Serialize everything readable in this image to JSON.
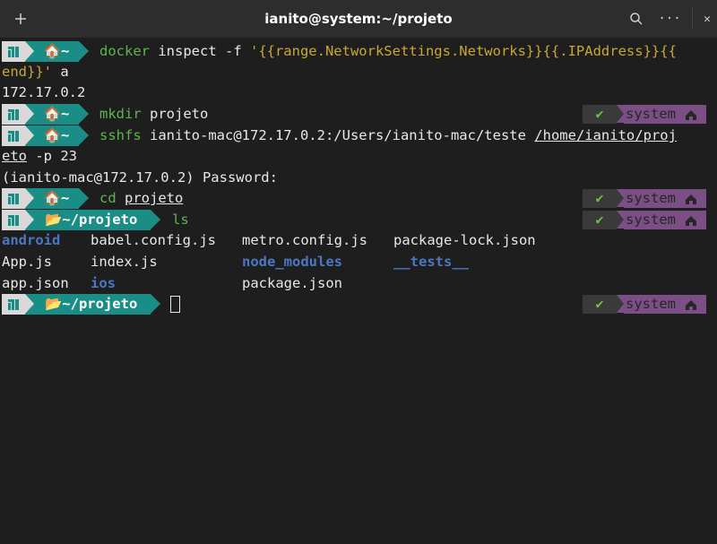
{
  "window": {
    "title": "ianito@system:~/projeto",
    "new_tab_label": "+",
    "search_icon": "search-icon",
    "menu_label": "···",
    "close_label": "✕"
  },
  "prompt": {
    "home_label": "🏠~",
    "dir_label": "📂~/projeto",
    "status_check": "✔",
    "status_label": "system"
  },
  "lines": {
    "l1_cmd": "docker",
    "l1_args": " inspect -f ",
    "l1_str": "'{{range.NetworkSettings.Networks}}{{.IPAddress}}{{",
    "l2_str": "end}}'",
    "l2_rest": " a",
    "l3": "172.17.0.2",
    "l4_cmd": "mkdir",
    "l4_args": " projeto",
    "l5_cmd": "sshfs",
    "l5_args": " ianito-mac@172.17.0.2:/Users/ianito-mac/teste ",
    "l5_path": "/home/ianito/proj",
    "l6_path": "eto",
    "l6_rest": " -p 23",
    "l7": "(ianito-mac@172.17.0.2) Password:",
    "l8_cmd": "cd",
    "l8_arg": "projeto",
    "l9_cmd": "ls"
  },
  "ls_output": {
    "r1": [
      "android",
      "babel.config.js",
      "metro.config.js",
      "package-lock.json"
    ],
    "r2": [
      "App.js",
      "index.js",
      "node_modules",
      "__tests__"
    ],
    "r3": [
      "app.json",
      "ios",
      "package.json"
    ]
  }
}
